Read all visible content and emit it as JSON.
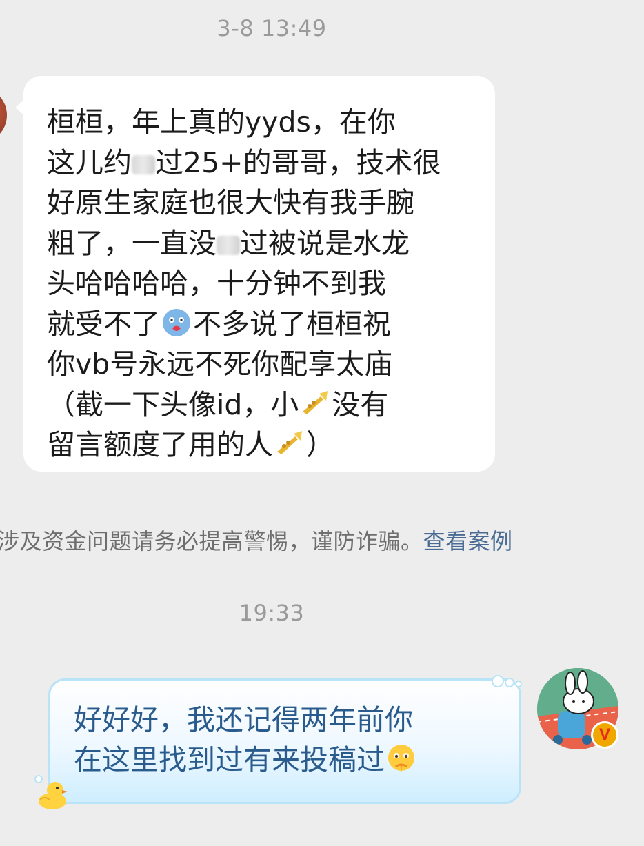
{
  "timestamps": {
    "first": "3-8 13:49",
    "second": "19:33"
  },
  "incoming_message": {
    "line1": "桓桓，年上真的yyds，在你",
    "line2_a": "这儿约",
    "line2_b": "过25+的哥哥，技术很",
    "line3": "好原生家庭也很大快有我手腕",
    "line4_a": "粗了，一直没",
    "line4_b": "过被说是水龙",
    "line5": "头哈哈哈哈，十分钟不到我",
    "line6_a": "就受不了",
    "line6_b": "不多说了桓桓祝",
    "line7": "你vb号永远不死你配享太庙",
    "line8_a": "（截一下头像id，小",
    "line8_b": "没有",
    "line9_a": "留言额度了用的人",
    "line9_b": "）"
  },
  "system_notice": {
    "text": "涉及资金问题请务必提高警惕，谨防诈骗。",
    "link": "查看案例"
  },
  "outgoing_message": {
    "line1": "好好好，我还记得两年前你",
    "line2": "在这里找到过有来投稿过"
  },
  "avatar_badge": "V",
  "icons": {
    "left_avatar": "avatar-image",
    "right_avatar": "bunny-avatar",
    "emoji_blue_face": "blue-face-heart-emoji",
    "emoji_trumpet": "trumpet-emoji",
    "emoji_pray": "pleading-pray-emoji",
    "duck": "duck-sticker-icon"
  }
}
